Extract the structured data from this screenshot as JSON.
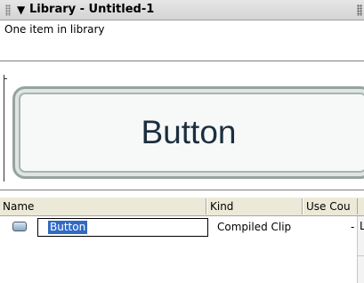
{
  "panel": {
    "title": "Library - Untitled-1",
    "collapse_glyph": "▼",
    "collapse_icon": "triangle-down-icon",
    "grip_icon": "gripper-icon",
    "options_icon": "panel-options-icon"
  },
  "status": {
    "item_count_text": "One item in library"
  },
  "preview": {
    "button_label": "Button"
  },
  "table": {
    "columns": [
      {
        "label": "Name"
      },
      {
        "label": "Kind"
      },
      {
        "label": "Use Cou"
      }
    ],
    "rows": [
      {
        "icon": "button-symbol-icon",
        "name": "Button",
        "kind": "Compiled Clip",
        "use_count": "-"
      }
    ],
    "right_edge_glyph": "L"
  }
}
